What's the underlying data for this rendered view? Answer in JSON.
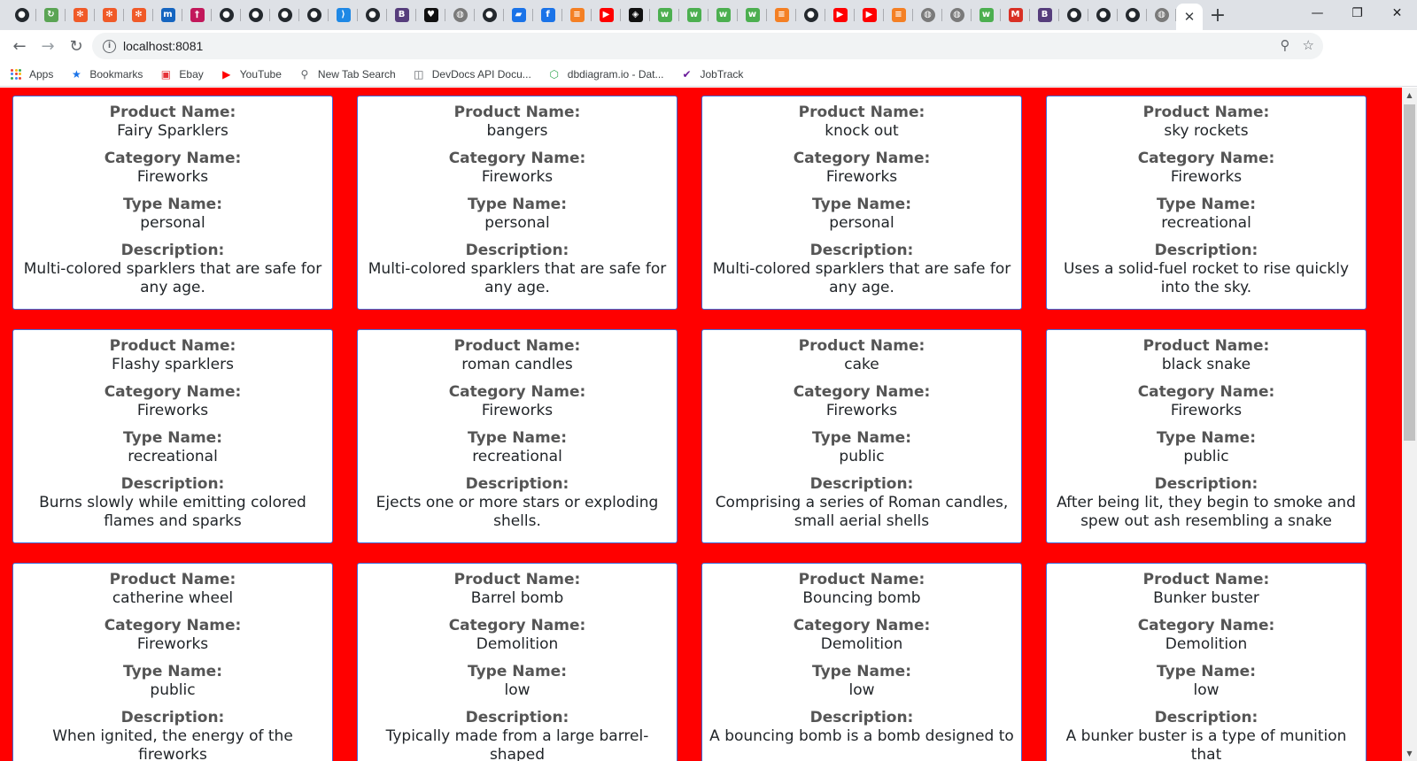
{
  "browser": {
    "tab_icons": [
      {
        "name": "github-icon",
        "glyph": "●",
        "bg": "#24292e"
      },
      {
        "name": "reload-extension-icon",
        "glyph": "↻",
        "bg": "#5aa454"
      },
      {
        "name": "asterisk-icon",
        "glyph": "✻",
        "bg": "#f05a28"
      },
      {
        "name": "asterisk-icon",
        "glyph": "✻",
        "bg": "#f05a28"
      },
      {
        "name": "asterisk-icon",
        "glyph": "✻",
        "bg": "#f05a28"
      },
      {
        "name": "m-logo-icon",
        "glyph": "m",
        "bg": "#1565c0"
      },
      {
        "name": "figure-icon",
        "glyph": "†",
        "bg": "#c2185b"
      },
      {
        "name": "github-icon",
        "glyph": "●",
        "bg": "#24292e"
      },
      {
        "name": "github-icon",
        "glyph": "●",
        "bg": "#24292e"
      },
      {
        "name": "github-icon",
        "glyph": "●",
        "bg": "#24292e"
      },
      {
        "name": "github-icon",
        "glyph": "●",
        "bg": "#24292e"
      },
      {
        "name": "vscode-icon",
        "glyph": "⟩",
        "bg": "#1e88e5"
      },
      {
        "name": "github-icon",
        "glyph": "●",
        "bg": "#24292e"
      },
      {
        "name": "bootstrap-icon",
        "glyph": "B",
        "bg": "#563d7c"
      },
      {
        "name": "heart-icon",
        "glyph": "♥",
        "bg": "#111111"
      },
      {
        "name": "globe-icon",
        "glyph": "◍",
        "bg": "#7a7a7a"
      },
      {
        "name": "github-icon",
        "glyph": "●",
        "bg": "#24292e"
      },
      {
        "name": "chat-icon",
        "glyph": "▰",
        "bg": "#1a73e8"
      },
      {
        "name": "info-icon",
        "glyph": "f",
        "bg": "#1a73e8"
      },
      {
        "name": "stackoverflow-icon",
        "glyph": "≡",
        "bg": "#f48024"
      },
      {
        "name": "youtube-icon",
        "glyph": "▶",
        "bg": "#ff0000"
      },
      {
        "name": "codepen-icon",
        "glyph": "◈",
        "bg": "#111111"
      },
      {
        "name": "w3schools-icon",
        "glyph": "w",
        "bg": "#4caf50"
      },
      {
        "name": "w3schools-icon",
        "glyph": "w",
        "bg": "#4caf50"
      },
      {
        "name": "w3schools-icon",
        "glyph": "w",
        "bg": "#4caf50"
      },
      {
        "name": "w3schools-icon",
        "glyph": "w",
        "bg": "#4caf50"
      },
      {
        "name": "stackoverflow-icon",
        "glyph": "≡",
        "bg": "#f48024"
      },
      {
        "name": "github-icon",
        "glyph": "●",
        "bg": "#24292e"
      },
      {
        "name": "youtube-icon",
        "glyph": "▶",
        "bg": "#ff0000"
      },
      {
        "name": "youtube-icon",
        "glyph": "▶",
        "bg": "#ff0000"
      },
      {
        "name": "stackoverflow-icon",
        "glyph": "≡",
        "bg": "#f48024"
      },
      {
        "name": "globe-icon",
        "glyph": "◍",
        "bg": "#7a7a7a"
      },
      {
        "name": "globe-icon",
        "glyph": "◍",
        "bg": "#7a7a7a"
      },
      {
        "name": "w3schools-icon",
        "glyph": "w",
        "bg": "#4caf50"
      },
      {
        "name": "gmail-icon",
        "glyph": "M",
        "bg": "#d93025"
      },
      {
        "name": "bootstrap-icon",
        "glyph": "B",
        "bg": "#563d7c"
      },
      {
        "name": "github-icon",
        "glyph": "●",
        "bg": "#24292e"
      },
      {
        "name": "github-icon",
        "glyph": "●",
        "bg": "#24292e"
      },
      {
        "name": "github-icon",
        "glyph": "●",
        "bg": "#24292e"
      },
      {
        "name": "globe-icon",
        "glyph": "◍",
        "bg": "#7a7a7a"
      }
    ],
    "active_tab_close": "✕",
    "new_tab": "+",
    "window_controls": {
      "minimize": "—",
      "restore": "❐",
      "close": "✕"
    },
    "url": "localhost:8081",
    "bookmarks": [
      {
        "label": "Apps",
        "icon": "apps-grid-icon"
      },
      {
        "label": "Bookmarks",
        "icon": "star-icon",
        "glyph": "★",
        "color": "#1a73e8"
      },
      {
        "label": "Ebay",
        "icon": "shopping-bag-icon",
        "glyph": "▣",
        "color": "#e53238"
      },
      {
        "label": "YouTube",
        "icon": "youtube-icon",
        "glyph": "▶",
        "color": "#ff0000"
      },
      {
        "label": "New Tab Search",
        "icon": "search-icon",
        "glyph": "⚲",
        "color": "#5f6368"
      },
      {
        "label": "DevDocs API Docu...",
        "icon": "devdocs-icon",
        "glyph": "◫",
        "color": "#5f6368"
      },
      {
        "label": "dbdiagram.io - Dat...",
        "icon": "dbdiagram-icon",
        "glyph": "⬡",
        "color": "#34a853"
      },
      {
        "label": "JobTrack",
        "icon": "checkbox-icon",
        "glyph": "✔",
        "color": "#6a1b9a"
      }
    ]
  },
  "labels": {
    "product": "Product Name:",
    "category": "Category Name:",
    "type": "Type Name:",
    "description": "Description:"
  },
  "products": [
    {
      "product": "Fairy Sparklers",
      "category": "Fireworks",
      "type": "personal",
      "description": "Multi-colored sparklers that are safe for any age."
    },
    {
      "product": "bangers",
      "category": "Fireworks",
      "type": "personal",
      "description": "Multi-colored sparklers that are safe for any age."
    },
    {
      "product": "knock out",
      "category": "Fireworks",
      "type": "personal",
      "description": "Multi-colored sparklers that are safe for any age."
    },
    {
      "product": "sky rockets",
      "category": "Fireworks",
      "type": "recreational",
      "description": "Uses a solid-fuel rocket to rise quickly into the sky."
    },
    {
      "product": "Flashy sparklers",
      "category": "Fireworks",
      "type": "recreational",
      "description": "Burns slowly while emitting colored flames and sparks"
    },
    {
      "product": "roman candles",
      "category": "Fireworks",
      "type": "recreational",
      "description": "Ejects one or more stars or exploding shells."
    },
    {
      "product": "cake",
      "category": "Fireworks",
      "type": "public",
      "description": "Comprising a series of Roman candles, small aerial shells"
    },
    {
      "product": "black snake",
      "category": "Fireworks",
      "type": "public",
      "description": "After being lit, they begin to smoke and spew out ash resembling a snake"
    },
    {
      "product": "catherine wheel",
      "category": "Fireworks",
      "type": "public",
      "description": "When ignited, the energy of the fireworks"
    },
    {
      "product": "Barrel bomb",
      "category": "Demolition",
      "type": "low",
      "description": "Typically made from a large barrel-shaped"
    },
    {
      "product": "Bouncing bomb",
      "category": "Demolition",
      "type": "low",
      "description": "A bouncing bomb is a bomb designed to"
    },
    {
      "product": "Bunker buster",
      "category": "Demolition",
      "type": "low",
      "description": "A bunker buster is a type of munition that"
    }
  ]
}
